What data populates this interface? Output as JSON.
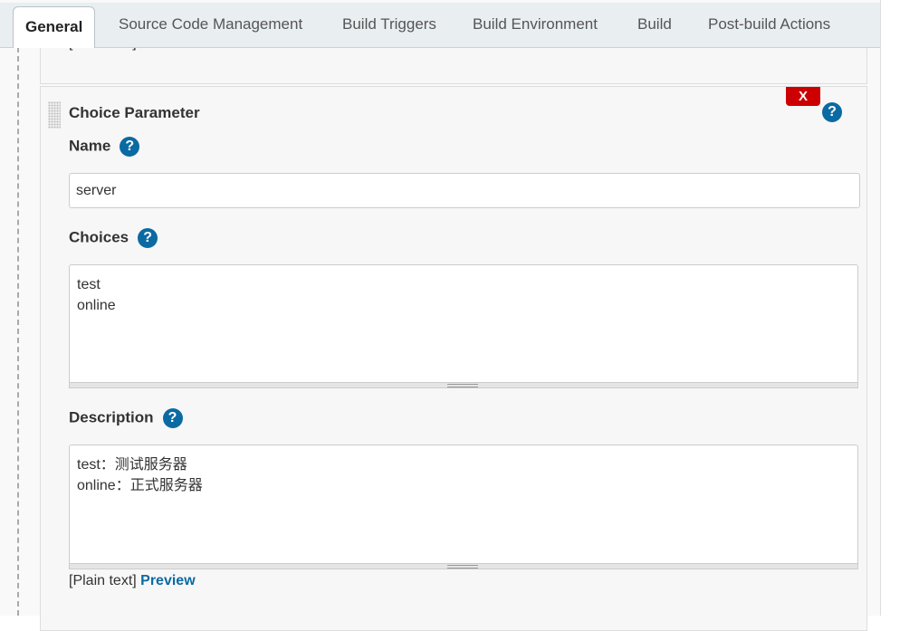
{
  "tabs": [
    "General",
    "Source Code Management",
    "Build Triggers",
    "Build Environment",
    "Build",
    "Post-build Actions"
  ],
  "prev_block": {
    "plain": "[Plain text]",
    "preview": "Preview"
  },
  "choice": {
    "title": "Choice Parameter",
    "delete": "X",
    "help": "?",
    "name_label": "Name",
    "name_value": "server",
    "choices_label": "Choices",
    "choices_value": "test\nonline",
    "description_label": "Description",
    "description_value": "test：测试服务器\nonline：正式服务器",
    "plain": "[Plain text]",
    "preview": "Preview"
  },
  "colors": {
    "delete": "#cc0000",
    "help": "#0b6aa2",
    "link": "#0b6aa2"
  }
}
